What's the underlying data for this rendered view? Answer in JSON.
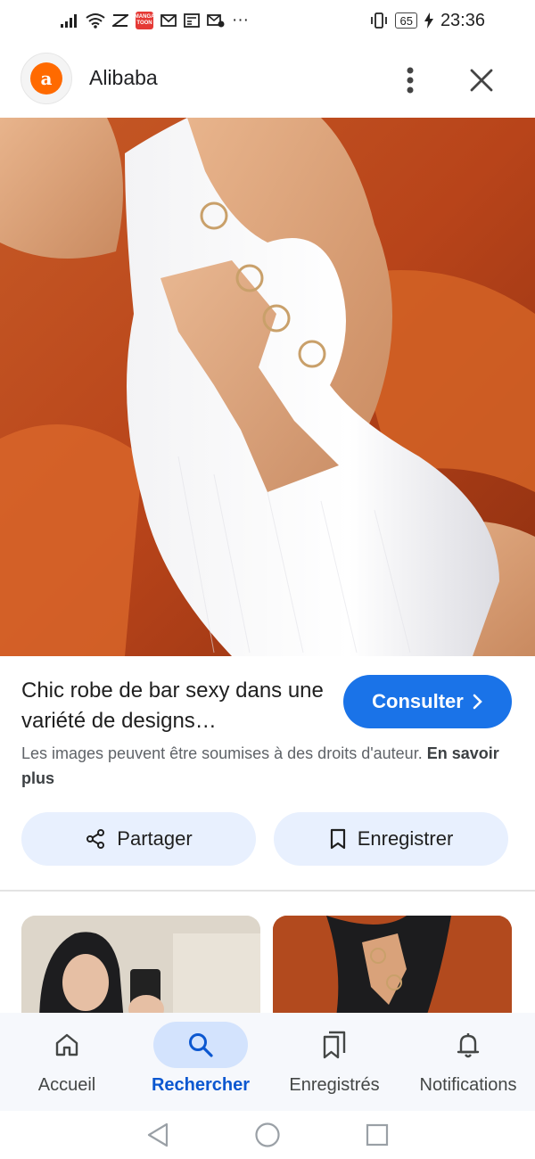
{
  "status_bar": {
    "icons": [
      "signal-icon",
      "wifi-icon",
      "data-saver-icon",
      "manga-app-icon",
      "gmail-icon",
      "news-icon",
      "mail-icon",
      "more-dots-icon",
      "vibrate-icon",
      "charging-icon"
    ],
    "app_badge_text": "MANGA TOON",
    "more_text": "···",
    "battery": "65",
    "time": "23:36"
  },
  "header": {
    "app_name": "Alibaba",
    "logo_letter": "a",
    "brand_color": "#ff6a00"
  },
  "product": {
    "title": "Chic robe de bar sexy dans une variété de designs…",
    "consult_label": "Consulter",
    "copyright_text": "Les images peuvent être soumises à des droits d'auteur.",
    "learn_more": "En savoir plus"
  },
  "actions": {
    "share_label": "Partager",
    "save_label": "Enregistrer"
  },
  "bottom_nav": {
    "items": [
      {
        "label": "Accueil",
        "icon": "home-icon",
        "active": false
      },
      {
        "label": "Rechercher",
        "icon": "search-icon",
        "active": true
      },
      {
        "label": "Enregistrés",
        "icon": "bookmarks-icon",
        "active": false
      },
      {
        "label": "Notifications",
        "icon": "bell-icon",
        "active": false
      }
    ]
  },
  "colors": {
    "accent": "#1a73e8",
    "chip_bg": "#e8f0fe",
    "active_nav_bg": "#d3e3fd",
    "active_nav_text": "#0b57d0"
  }
}
